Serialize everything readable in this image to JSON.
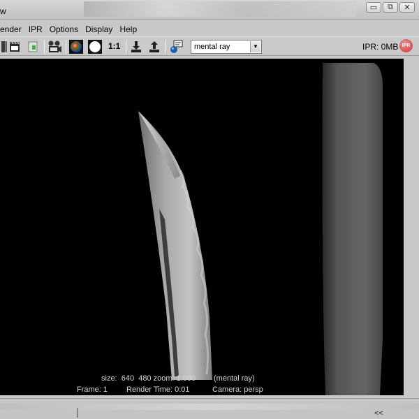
{
  "window": {
    "title": "w",
    "controls": [
      "▭",
      "⧉",
      "✕"
    ]
  },
  "menu": {
    "items": [
      "ender",
      "IPR",
      "Options",
      "Display",
      "Help"
    ]
  },
  "toolbar": {
    "ratio_label": "1:1",
    "renderer": "mental ray",
    "ipr_memory": "IPR: 0MB",
    "ipr_badge": "IPR",
    "icons": [
      "render-frame-icon",
      "redo-render-icon",
      "render-region-icon",
      "snapshot-icon",
      "color-channels-icon",
      "alpha-channel-icon",
      "keep-image-icon",
      "remove-image-icon",
      "render-settings-icon"
    ]
  },
  "viewport": {
    "hud_line1_size": "size:  640  480 zoom: 1.000",
    "hud_line1_renderer": "(mental ray)",
    "hud_line2_frame": "Frame: 1",
    "hud_line2_time": "Render Time: 0:01",
    "hud_line2_camera": "Camera: persp"
  },
  "bottom": {
    "collapse": "<<"
  }
}
